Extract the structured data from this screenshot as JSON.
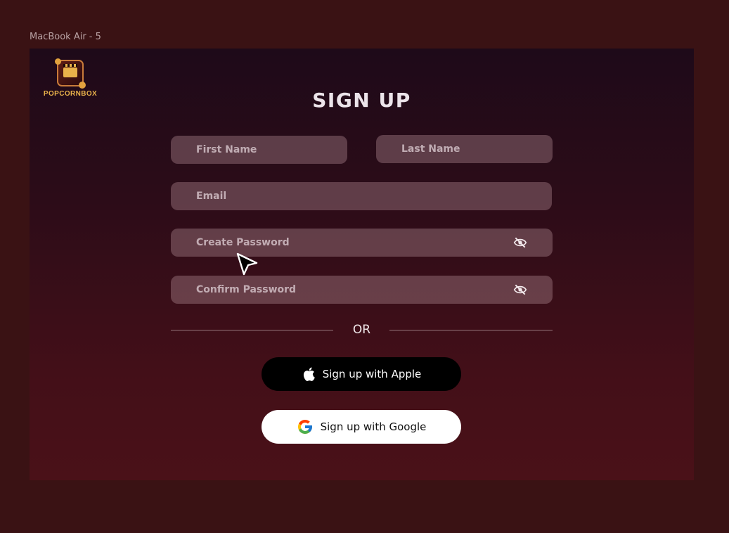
{
  "frame": {
    "label": "MacBook Air - 5"
  },
  "logo": {
    "text": "POPCORNBOX"
  },
  "page": {
    "title": "SIGN UP"
  },
  "form": {
    "first_name_placeholder": "First Name",
    "last_name_placeholder": "Last Name",
    "email_placeholder": "Email",
    "password_placeholder": "Create Password",
    "confirm_password_placeholder": "Confirm Password"
  },
  "divider": {
    "text": "OR"
  },
  "social": {
    "apple_label": "Sign up with Apple",
    "google_label": "Sign up with Google"
  },
  "icons": {
    "password_toggle": "eye-slash-icon",
    "apple": "apple-logo-icon",
    "google": "google-logo-icon",
    "cursor": "mouse-pointer-icon"
  },
  "colors": {
    "background": "#3a1214",
    "frame_top": "#1e0a19",
    "frame_bottom": "#4a1118",
    "brand": "#e8b14a",
    "field_fill": "#6e5560",
    "apple_button": "#000000",
    "google_button": "#ffffff"
  }
}
